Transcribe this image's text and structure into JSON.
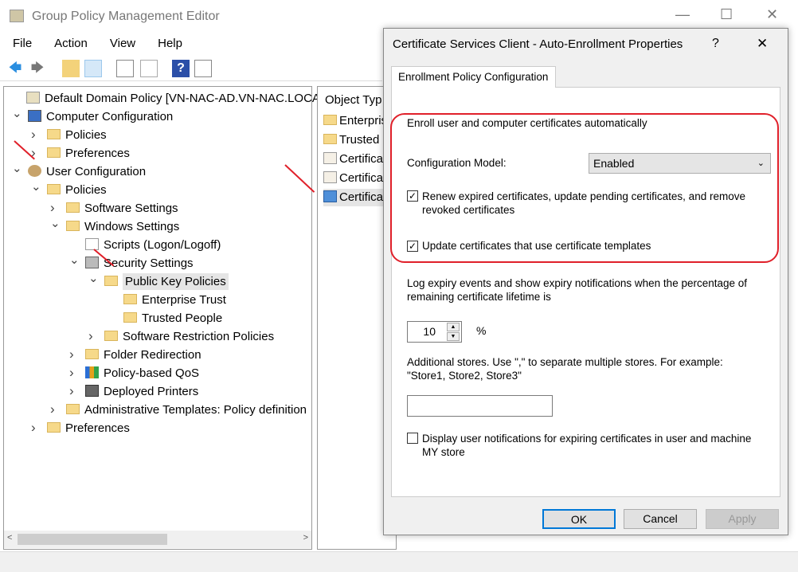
{
  "window": {
    "title": "Group Policy Management Editor",
    "minimize": "—",
    "maximize": "☐",
    "close": "✕"
  },
  "menu": [
    "File",
    "Action",
    "View",
    "Help"
  ],
  "toolbar": {
    "back": "🡄",
    "forward": "🡆",
    "up": "⬏",
    "help": "?"
  },
  "tree": [
    {
      "label": "Default Domain Policy [VN-NAC-AD.VN-NAC.LOCAL",
      "level": 0,
      "chev": "",
      "icon": "scroll"
    },
    {
      "label": "Computer Configuration",
      "level": 0,
      "chev": "v",
      "icon": "computer"
    },
    {
      "label": "Policies",
      "level": 1,
      "chev": ">",
      "icon": "folder"
    },
    {
      "label": "Preferences",
      "level": 1,
      "chev": ">",
      "icon": "folder"
    },
    {
      "label": "User Configuration",
      "level": 0,
      "chev": "v",
      "icon": "user"
    },
    {
      "label": "Policies",
      "level": 1,
      "chev": "v",
      "icon": "folder"
    },
    {
      "label": "Software Settings",
      "level": 2,
      "chev": ">",
      "icon": "folder"
    },
    {
      "label": "Windows Settings",
      "level": 2,
      "chev": "v",
      "icon": "folder"
    },
    {
      "label": "Scripts (Logon/Logoff)",
      "level": 3,
      "chev": "",
      "icon": "script"
    },
    {
      "label": "Security Settings",
      "level": 3,
      "chev": "v",
      "icon": "lock"
    },
    {
      "label": "Public Key Policies",
      "level": 4,
      "chev": "v",
      "icon": "folder",
      "selected": true
    },
    {
      "label": "Enterprise Trust",
      "level": 5,
      "chev": "",
      "icon": "folder"
    },
    {
      "label": "Trusted People",
      "level": 5,
      "chev": "",
      "icon": "folder"
    },
    {
      "label": "Software Restriction Policies",
      "level": 4,
      "chev": ">",
      "icon": "folder"
    },
    {
      "label": "Folder Redirection",
      "level": 3,
      "chev": ">",
      "icon": "folder"
    },
    {
      "label": "Policy-based QoS",
      "level": 3,
      "chev": ">",
      "icon": "chart"
    },
    {
      "label": "Deployed Printers",
      "level": 3,
      "chev": ">",
      "icon": "printer"
    },
    {
      "label": "Administrative Templates: Policy definition",
      "level": 2,
      "chev": ">",
      "icon": "folder"
    },
    {
      "label": "Preferences",
      "level": 1,
      "chev": ">",
      "icon": "folder"
    }
  ],
  "right_pane": {
    "header": "Object Typ",
    "items": [
      {
        "label": "Enterpris",
        "icon": "folder"
      },
      {
        "label": "Trusted",
        "icon": "folder"
      },
      {
        "label": "Certifica",
        "icon": "cert"
      },
      {
        "label": "Certifica",
        "icon": "cert"
      },
      {
        "label": "Certifica",
        "icon": "cert-blue",
        "selected": true
      }
    ]
  },
  "dialog": {
    "title": "Certificate Services Client - Auto-Enrollment Properties",
    "help": "?",
    "close": "✕",
    "tab": "Enrollment Policy Configuration",
    "heading": "Enroll user and computer certificates automatically",
    "config_model_label": "Configuration Model:",
    "config_model_value": "Enabled",
    "renew_label": "Renew expired certificates, update pending certificates, and remove revoked certificates",
    "renew_checked": true,
    "update_label": "Update certificates that use certificate templates",
    "update_checked": true,
    "expiry_label": "Log expiry events and show expiry notifications when the percentage of remaining certificate lifetime is",
    "expiry_value": "10",
    "percent": "%",
    "stores_label": "Additional stores. Use \",\" to separate multiple stores. For example: \"Store1, Store2, Store3\"",
    "stores_value": "",
    "notify_label": "Display user notifications for expiring certificates in user and machine MY store",
    "notify_checked": false,
    "ok": "OK",
    "cancel": "Cancel",
    "apply": "Apply",
    "check": "✓"
  },
  "annotation_color": "#e0202a"
}
